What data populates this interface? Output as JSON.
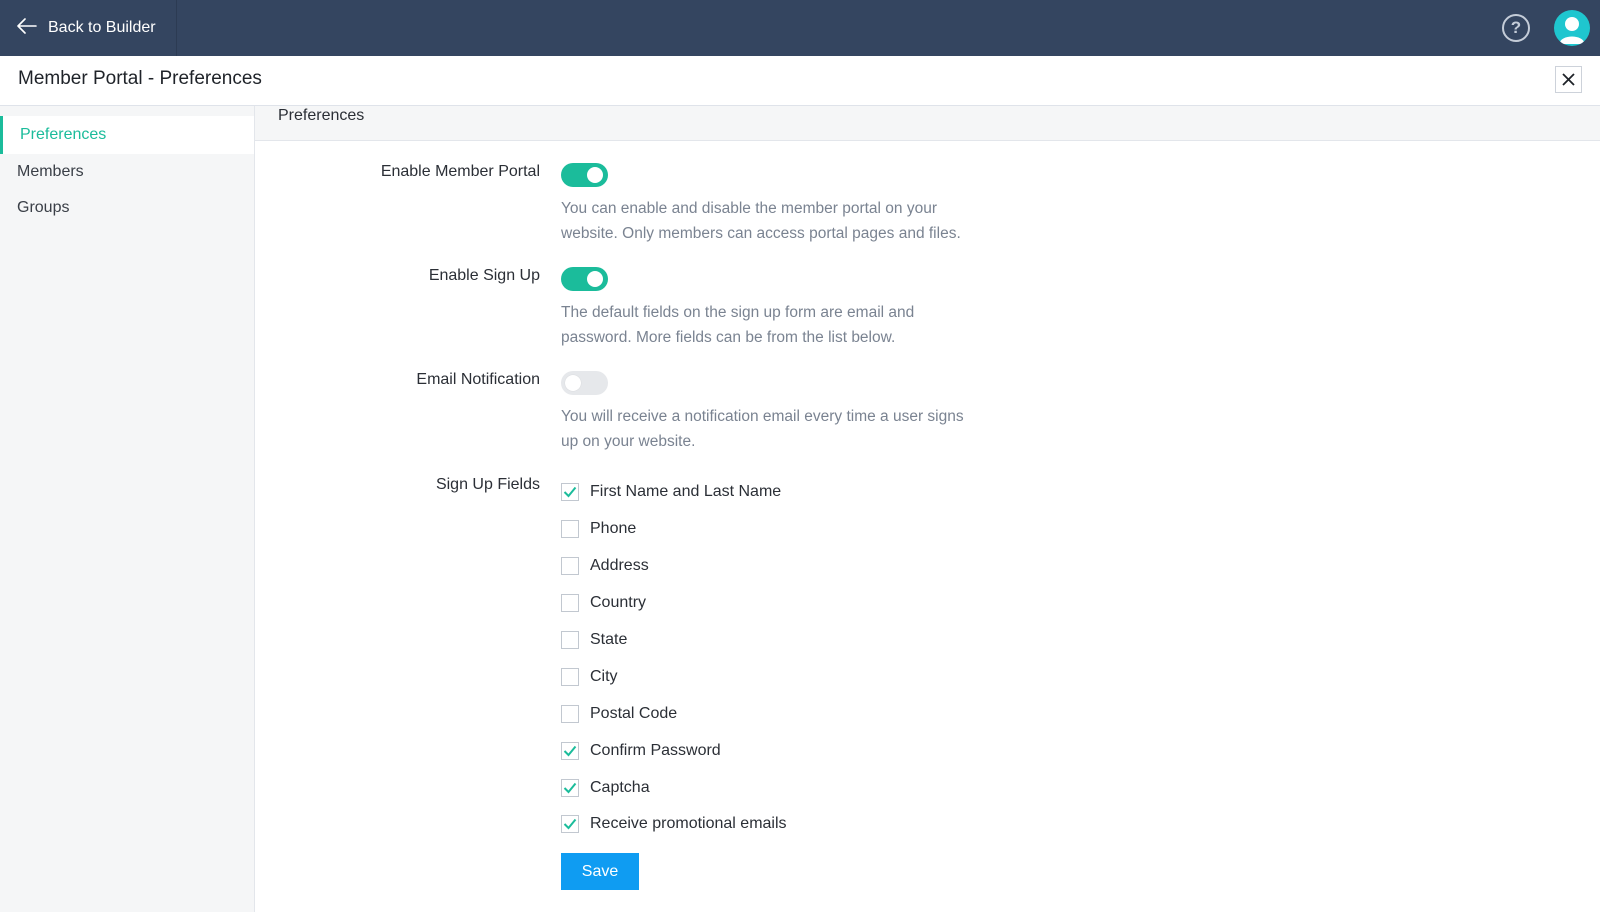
{
  "topbar": {
    "back_label": "Back to Builder",
    "help_icon": "?"
  },
  "titlebar": {
    "title": "Member Portal - Preferences"
  },
  "sidebar": {
    "items": [
      {
        "label": "Preferences",
        "active": true
      },
      {
        "label": "Members",
        "active": false
      },
      {
        "label": "Groups",
        "active": false
      }
    ]
  },
  "section": {
    "title": "Preferences"
  },
  "settings": {
    "enable_portal": {
      "label": "Enable Member Portal",
      "on": true,
      "desc": [
        "You can enable and disable the member portal on your",
        "website. Only members can access portal pages and files."
      ]
    },
    "enable_signup": {
      "label": "Enable Sign Up",
      "on": true,
      "desc": [
        "The default fields on the sign up form are email and",
        "password. More fields can be from the list below."
      ]
    },
    "email_notification": {
      "label": "Email Notification",
      "on": false,
      "desc": [
        "You will receive a notification email every time a user signs",
        "up on your website."
      ]
    }
  },
  "signup_fields": {
    "label": "Sign Up Fields",
    "items": [
      {
        "label": "First Name and Last Name",
        "checked": true
      },
      {
        "label": "Phone",
        "checked": false
      },
      {
        "label": "Address",
        "checked": false
      },
      {
        "label": "Country",
        "checked": false
      },
      {
        "label": "State",
        "checked": false
      },
      {
        "label": "City",
        "checked": false
      },
      {
        "label": "Postal Code",
        "checked": false
      },
      {
        "label": "Confirm Password",
        "checked": true
      },
      {
        "label": "Captcha",
        "checked": true
      },
      {
        "label": "Receive promotional emails",
        "checked": true
      }
    ]
  },
  "save_label": "Save",
  "colors": {
    "topbar": "#344560",
    "accent": "#1bbc9b",
    "button": "#0f9cf2",
    "avatar": "#1fc6cf"
  }
}
